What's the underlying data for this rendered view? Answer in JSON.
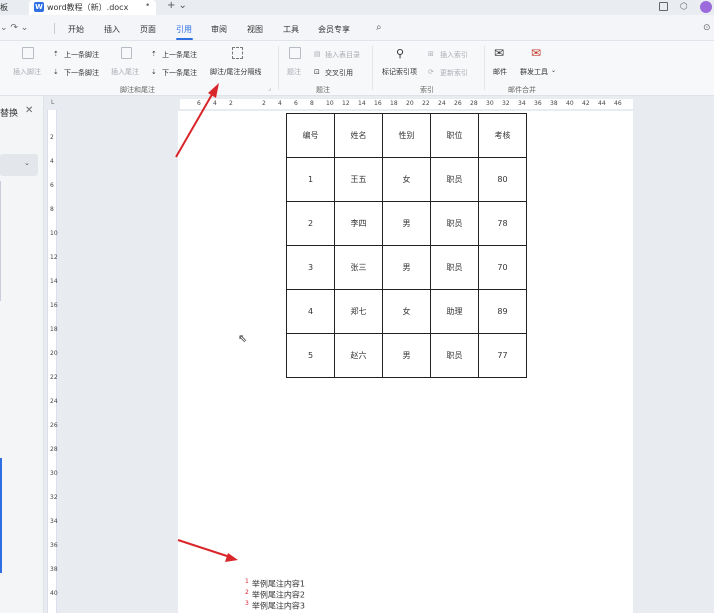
{
  "titlebar": {
    "left_fragment": "板",
    "tab_title": "word教程（新）.docx",
    "tab_dot": "•",
    "new_tab": "+ ⌄"
  },
  "menubar": {
    "items": [
      "开始",
      "插入",
      "页面",
      "引用",
      "审阅",
      "视图",
      "工具",
      "会员专享"
    ],
    "active": "引用"
  },
  "ribbon": {
    "insert_footnote": "插入脚注",
    "prev_footnote": "上一条脚注",
    "next_footnote": "下一条脚注",
    "insert_endnote": "插入尾注",
    "prev_endnote": "上一条尾注",
    "next_endnote": "下一条尾注",
    "separator_line": "脚注/尾注分隔线",
    "caption": "题注",
    "insert_table_of_figures": "插入表目录",
    "cross_reference": "交叉引用",
    "mark_index_entry": "标记索引项",
    "insert_index": "插入索引",
    "update_index": "更新索引",
    "mail": "邮件",
    "mass_tools": "群发工具",
    "group_footnote": "脚注和尾注",
    "group_caption": "题注",
    "group_index": "索引",
    "group_mail": "邮件合并"
  },
  "leftpane": {
    "label": "替换",
    "close": "✕"
  },
  "ruler_h": [
    "6",
    "4",
    "2",
    "2",
    "4",
    "6",
    "8",
    "10",
    "12",
    "14",
    "16",
    "18",
    "20",
    "22",
    "24",
    "26",
    "28",
    "30",
    "32",
    "34",
    "36",
    "38",
    "40",
    "42",
    "44",
    "46"
  ],
  "ruler_v": [
    "2",
    "4",
    "6",
    "8",
    "10",
    "12",
    "14",
    "16",
    "18",
    "20",
    "22",
    "24",
    "26",
    "28",
    "30",
    "32",
    "34",
    "36",
    "38",
    "40"
  ],
  "table": {
    "headers": [
      "编号",
      "姓名",
      "性别",
      "职位",
      "考核"
    ],
    "rows": [
      [
        "1",
        "王五",
        "女",
        "职员",
        "80"
      ],
      [
        "2",
        "李四",
        "男",
        "职员",
        "78"
      ],
      [
        "3",
        "张三",
        "男",
        "职员",
        "70"
      ],
      [
        "4",
        "郑七",
        "女",
        "助理",
        "89"
      ],
      [
        "5",
        "赵六",
        "男",
        "职员",
        "77"
      ]
    ]
  },
  "endnotes": [
    "举例尾注内容1",
    "举例尾注内容2",
    "举例尾注内容3"
  ],
  "colors": {
    "accent": "#2f6fe4",
    "arrow": "#d9262a"
  }
}
